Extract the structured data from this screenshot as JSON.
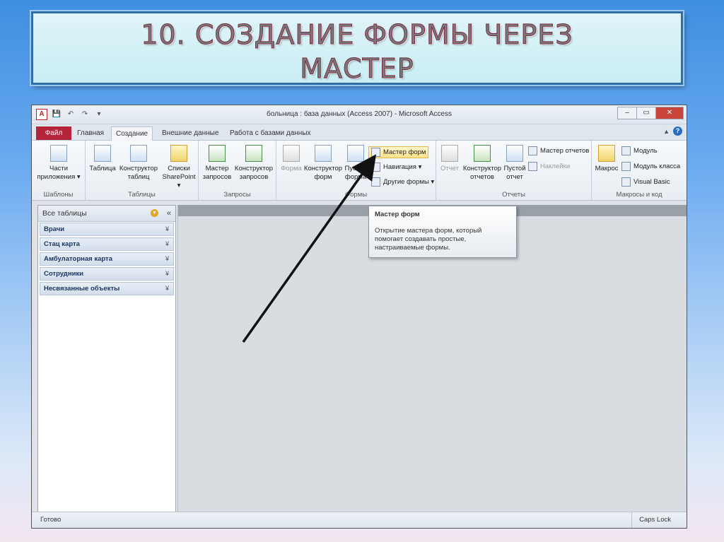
{
  "slide": {
    "title_line1": "10. СОЗДАНИЕ ФОРМЫ ЧЕРЕЗ",
    "title_line2": "МАСТЕР"
  },
  "window": {
    "title": "больница : база данных (Access 2007) - Microsoft Access",
    "qat": [
      "A",
      "💾",
      "↶",
      "↷",
      "▾"
    ]
  },
  "tabs": [
    {
      "label": "Файл"
    },
    {
      "label": "Главная"
    },
    {
      "label": "Создание"
    },
    {
      "label": "Внешние данные"
    },
    {
      "label": "Работа с базами данных"
    }
  ],
  "ribbon": {
    "groups": {
      "templates": "Шаблоны",
      "tables": "Таблицы",
      "queries": "Запросы",
      "forms": "Формы",
      "reports": "Отчеты",
      "macros": "Макросы и код"
    },
    "buttons": {
      "app_parts": "Части приложения ▾",
      "table": "Таблица",
      "table_designer": "Конструктор таблиц",
      "sharepoint": "Списки SharePoint ▾",
      "query_wizard": "Мастер запросов",
      "query_designer": "Конструктор запросов",
      "form": "Форма",
      "form_designer": "Конструктор форм",
      "blank_form": "Пустая форма",
      "form_wizard": "Мастер форм",
      "navigation": "Навигация ▾",
      "other_forms": "Другие формы ▾",
      "report": "Отчет",
      "report_designer": "Конструктор отчетов",
      "blank_report": "Пустой отчет",
      "report_wizard": "Мастер отчетов",
      "labels": "Наклейки",
      "macro": "Макрос",
      "module": "Модуль",
      "class_module": "Модуль класса",
      "visual_basic": "Visual Basic"
    }
  },
  "nav_pane": {
    "header": "Все таблицы",
    "items": [
      {
        "label": "Врачи"
      },
      {
        "label": "Стац карта"
      },
      {
        "label": "Амбулаторная карта"
      },
      {
        "label": "Сотрудники"
      },
      {
        "label": "Несвязанные объекты"
      }
    ]
  },
  "tooltip": {
    "title": "Мастер форм",
    "body": "Открытие мастера форм, который помогает создавать простые, настраиваемые формы."
  },
  "status": {
    "left": "Готово",
    "right": "Caps Lock"
  }
}
